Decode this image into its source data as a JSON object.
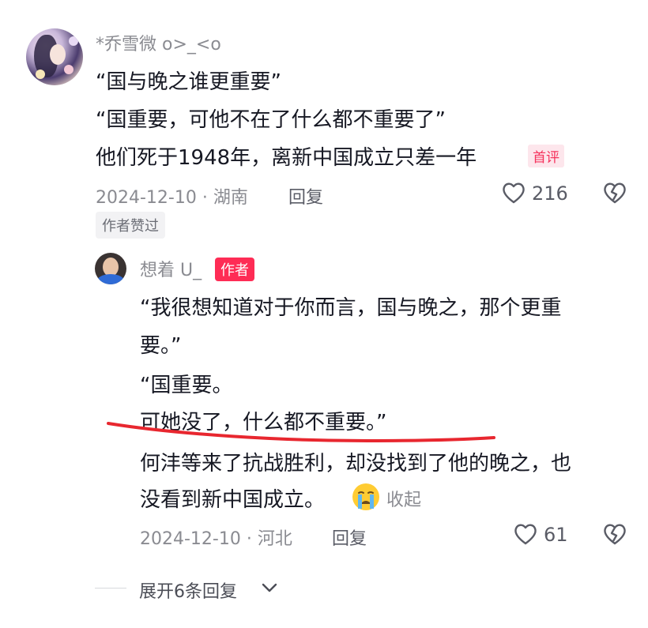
{
  "comment": {
    "username": "*乔雪微 o>_<o",
    "lines": [
      "“国与晚之谁更重要”",
      "“国重要，可他不在了什么都不重要了”",
      "他们死于1948年，离新中国成立只差一年"
    ],
    "first_comment_badge": "首评",
    "meta": "2024-12-10 · 湖南",
    "reply_label": "回复",
    "like_count": "216",
    "author_liked_badge": "作者赞过"
  },
  "reply": {
    "username": "想着 U_",
    "author_badge": "作者",
    "lines": [
      "“我很想知道对于你而言，国与晚之，那个更重",
      "要。”",
      "“国重要。",
      "可她没了，什么都不重要。”",
      "何沣等来了抗战胜利，却没找到了他的晚之，也",
      "没看到新中国成立。"
    ],
    "emoji": "😭",
    "collapse_label": "收起",
    "meta": "2024-12-10 · 河北",
    "reply_label": "回复",
    "like_count": "61"
  },
  "thread": {
    "expand_label": "展开6条回复"
  },
  "colors": {
    "accent_red": "#fe2c55",
    "underline_red": "#e8272f",
    "muted_text": "#8a8b91"
  },
  "icons": [
    "heart-icon",
    "broken-heart-icon",
    "chevron-down-icon",
    "crying-face-emoji"
  ]
}
